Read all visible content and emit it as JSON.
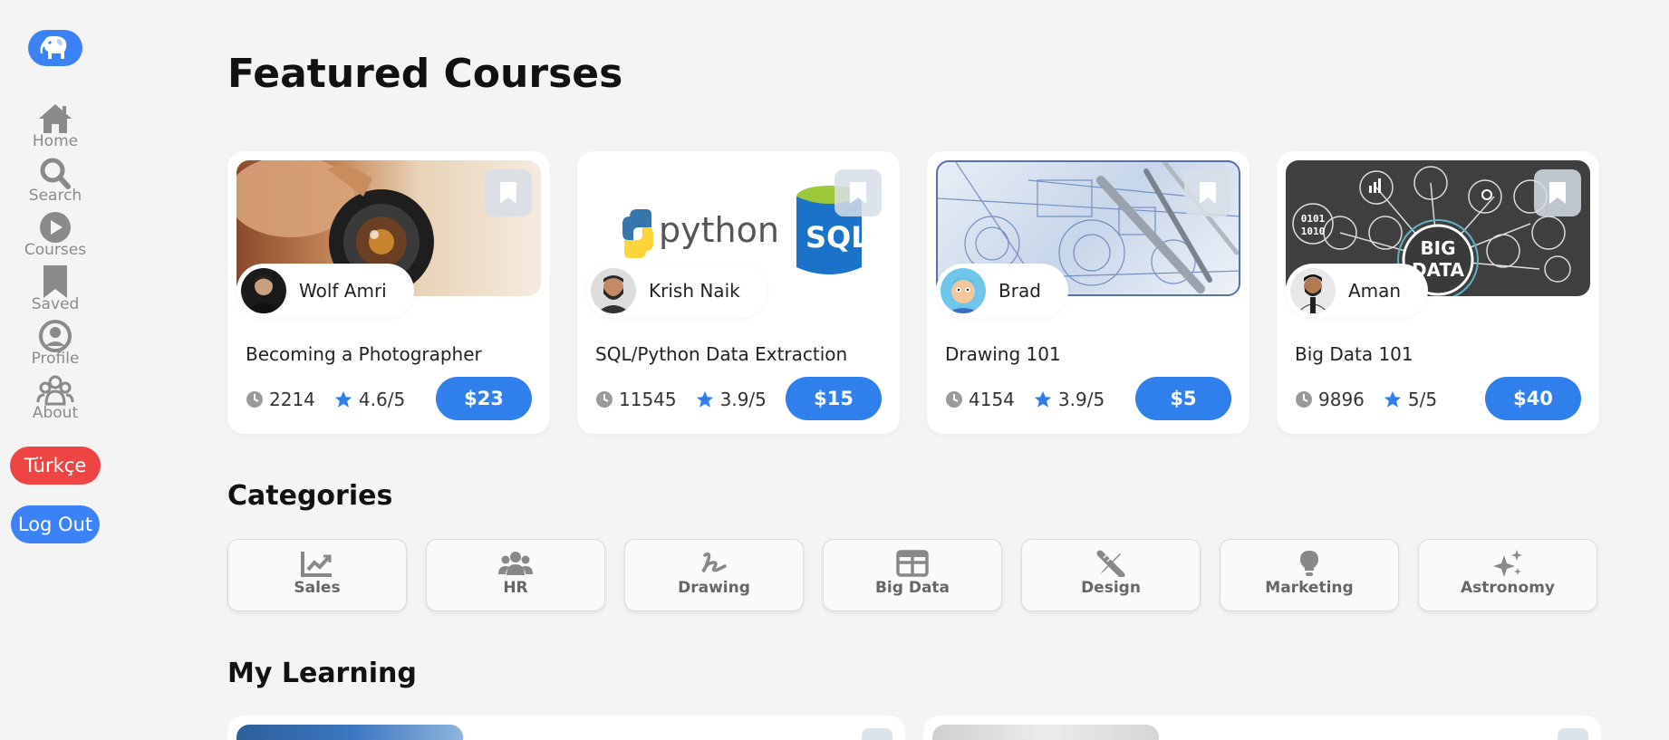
{
  "sidebar": {
    "logo_icon": "elephant-icon",
    "items": [
      {
        "label": "Home",
        "icon": "home-icon"
      },
      {
        "label": "Search",
        "icon": "search-icon"
      },
      {
        "label": "Courses",
        "icon": "play-icon"
      },
      {
        "label": "Saved",
        "icon": "bookmark-icon"
      },
      {
        "label": "Profile",
        "icon": "user-icon"
      },
      {
        "label": "About",
        "icon": "users-icon"
      }
    ],
    "language_button": "Türkçe",
    "logout_button": "Log Out"
  },
  "featured": {
    "title": "Featured Courses",
    "courses": [
      {
        "title": "Becoming a Photographer",
        "author": "Wolf Amri",
        "views": "2214",
        "rating": "4.6/5",
        "price": "$23"
      },
      {
        "title": "SQL/Python Data Extraction",
        "author": "Krish Naik",
        "views": "11545",
        "rating": "3.9/5",
        "price": "$15",
        "image_text_left": "python",
        "image_text_right": "SQL"
      },
      {
        "title": "Drawing 101",
        "author": "Brad",
        "views": "4154",
        "rating": "3.9/5",
        "price": "$5"
      },
      {
        "title": "Big Data 101",
        "author": "Aman",
        "views": "9896",
        "rating": "5/5",
        "price": "$40",
        "image_text_1": "BIG",
        "image_text_2": "DATA",
        "image_text_3": "0101",
        "image_text_4": "1010"
      }
    ]
  },
  "categories": {
    "title": "Categories",
    "items": [
      {
        "label": "Sales",
        "icon": "chart-line-icon"
      },
      {
        "label": "HR",
        "icon": "users-icon"
      },
      {
        "label": "Drawing",
        "icon": "signature-icon"
      },
      {
        "label": "Big Data",
        "icon": "table-icon"
      },
      {
        "label": "Design",
        "icon": "pen-ruler-icon"
      },
      {
        "label": "Marketing",
        "icon": "lightbulb-icon"
      },
      {
        "label": "Astronomy",
        "icon": "sparkles-icon"
      }
    ]
  },
  "learning": {
    "title": "My Learning"
  },
  "colors": {
    "accent": "#2f80ed",
    "danger": "#ef4444",
    "background": "#f4f4f4"
  }
}
